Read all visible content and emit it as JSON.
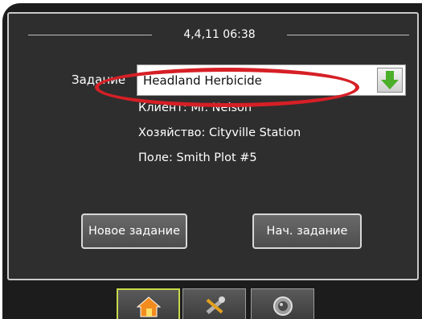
{
  "header": {
    "datetime": "4,4,11 06:38"
  },
  "job": {
    "label": "Задание",
    "selected": "Headland Herbicide",
    "client": "Клиент: Mr. Nelson",
    "farm": "Хозяйство: Cityville Station",
    "field": "Поле: Smith Plot #5"
  },
  "actions": {
    "new_job": "Новое задание",
    "start_job": "Нач. задание"
  },
  "tabs": [
    {
      "icon": "home-icon",
      "active": true
    },
    {
      "icon": "tools-icon",
      "active": false
    },
    {
      "icon": "camera-icon",
      "active": false
    }
  ],
  "colors": {
    "panel": "#2e2e2e",
    "active_tab_border": "#c8d94a",
    "dropdown_arrow": "#4caf2a",
    "annotation": "#d61f26"
  }
}
